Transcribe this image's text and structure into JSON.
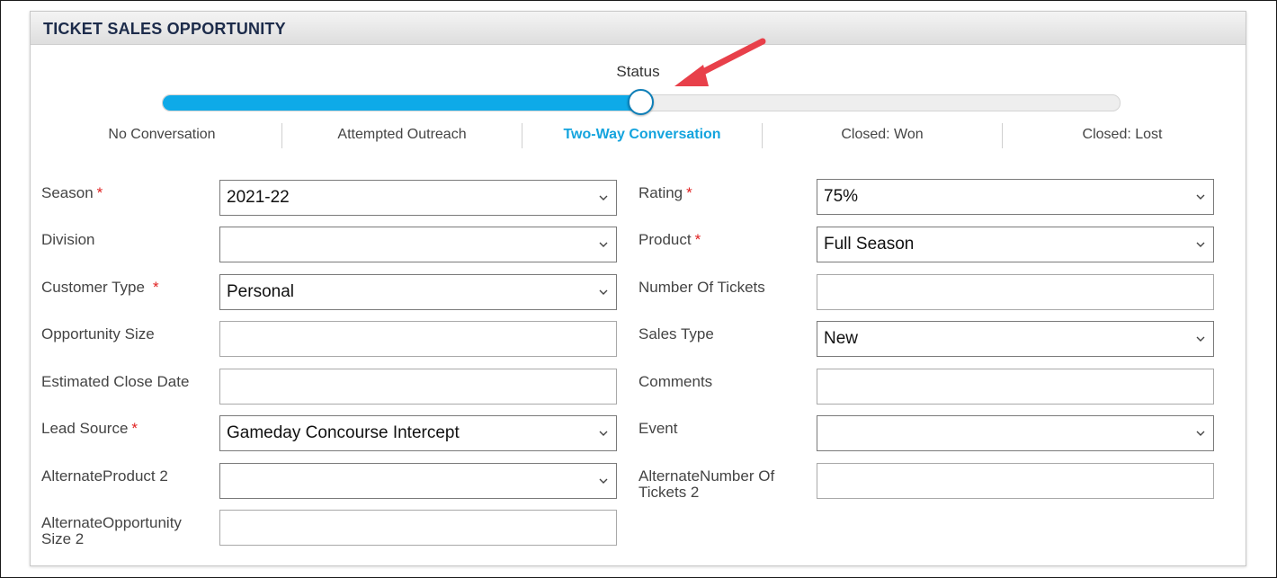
{
  "panel": {
    "title": "TICKET SALES OPPORTUNITY"
  },
  "status": {
    "label": "Status",
    "progress_fraction": 0.5,
    "stages": [
      {
        "label": "No Conversation",
        "active": false
      },
      {
        "label": "Attempted Outreach",
        "active": false
      },
      {
        "label": "Two-Way Conversation",
        "active": true
      },
      {
        "label": "Closed: Won",
        "active": false
      },
      {
        "label": "Closed: Lost",
        "active": false
      }
    ],
    "colors": {
      "fill": "#0eaae8",
      "active_text": "#14a4de",
      "arrow": "#e8404a"
    }
  },
  "form": {
    "season": {
      "label": "Season",
      "required": "*",
      "value": "2021-22"
    },
    "division": {
      "label": "Division",
      "value": ""
    },
    "customer_type": {
      "label": "Customer Type",
      "required": "*",
      "value": "Personal"
    },
    "opportunity_size": {
      "label": "Opportunity Size",
      "value": ""
    },
    "estimated_close_date": {
      "label": "Estimated Close Date",
      "value": ""
    },
    "lead_source": {
      "label": "Lead Source",
      "required": "*",
      "value": "Gameday Concourse Intercept"
    },
    "alternate_product_2": {
      "label": "AlternateProduct 2",
      "value": ""
    },
    "alternate_opportunity_size_2": {
      "label": "AlternateOpportunity Size 2",
      "value": ""
    },
    "rating": {
      "label": "Rating",
      "required": "*",
      "value": "75%"
    },
    "product": {
      "label": "Product",
      "required": "*",
      "value": "Full Season"
    },
    "number_of_tickets": {
      "label": "Number Of Tickets",
      "value": ""
    },
    "sales_type": {
      "label": "Sales Type",
      "value": "New"
    },
    "comments": {
      "label": "Comments",
      "value": ""
    },
    "event": {
      "label": "Event",
      "value": ""
    },
    "alternate_number_of_tickets_2": {
      "label": "AlternateNumber Of Tickets 2",
      "value": ""
    }
  }
}
